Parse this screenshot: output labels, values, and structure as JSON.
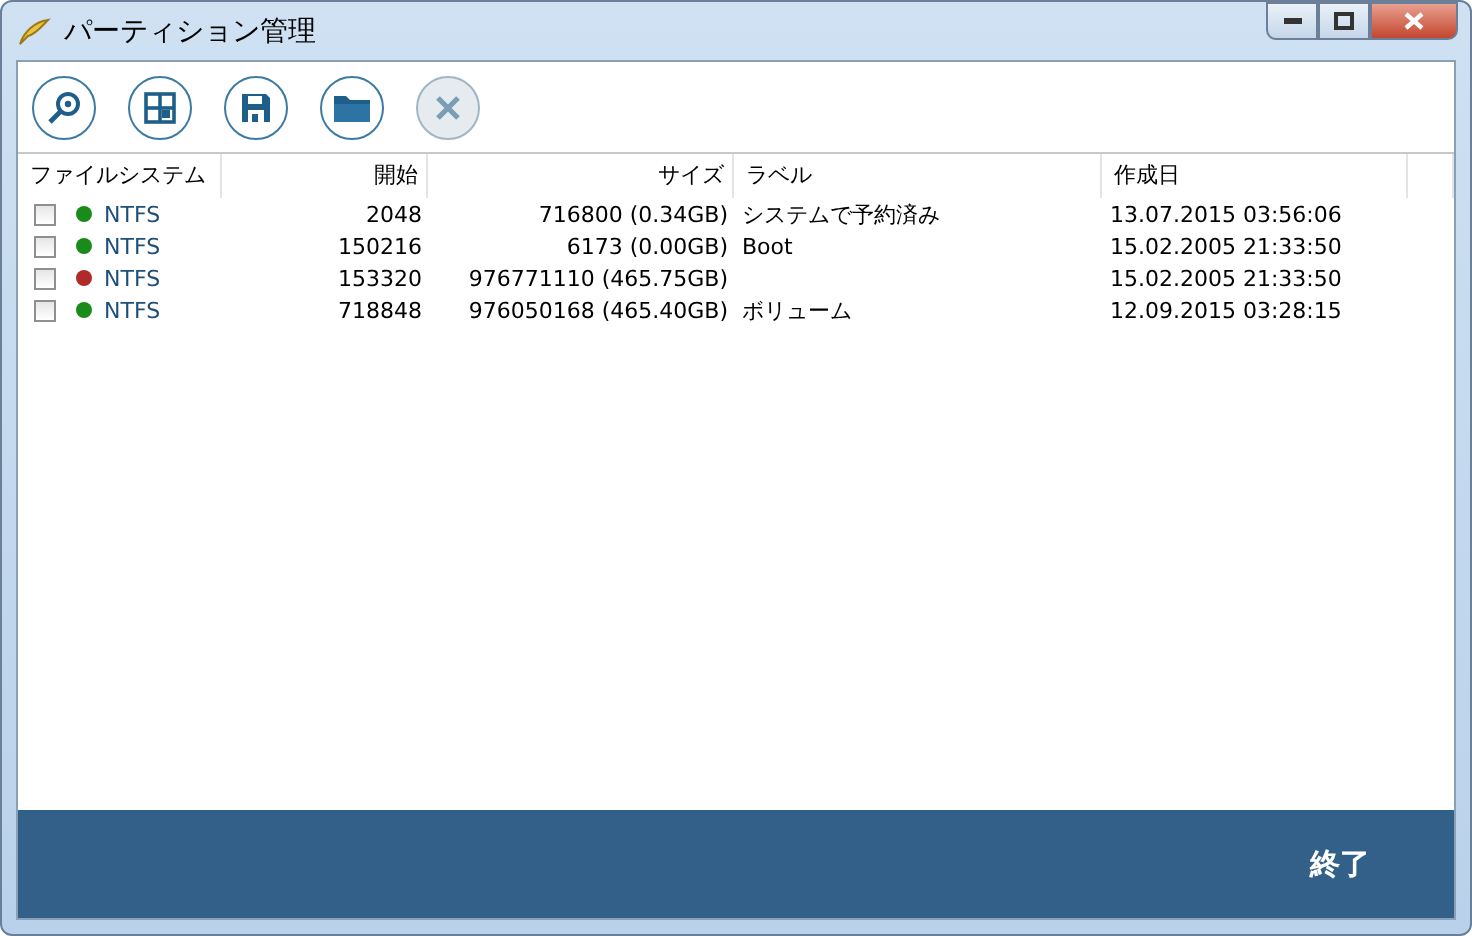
{
  "window": {
    "title": "パーティション管理"
  },
  "toolbar": [
    {
      "kind": "search",
      "disabled": false
    },
    {
      "kind": "grid",
      "disabled": false
    },
    {
      "kind": "save",
      "disabled": false
    },
    {
      "kind": "folder",
      "disabled": false
    },
    {
      "kind": "close",
      "disabled": true
    }
  ],
  "table": {
    "columns": [
      "ファイルシステム",
      "開始",
      "サイズ",
      "ラベル",
      "作成日"
    ],
    "rows": [
      {
        "checked": false,
        "color": "#1a8a1a",
        "filesystem": "NTFS",
        "start": "2048",
        "size": "716800 (0.34GB)",
        "label": "システムで予約済み",
        "created": "13.07.2015 03:56:06"
      },
      {
        "checked": false,
        "color": "#1a8a1a",
        "filesystem": "NTFS",
        "start": "150216",
        "size": "6173 (0.00GB)",
        "label": "Boot",
        "created": "15.02.2005 21:33:50"
      },
      {
        "checked": false,
        "color": "#b02a2a",
        "filesystem": "NTFS",
        "start": "153320",
        "size": "976771110 (465.75GB)",
        "created": "15.02.2005 21:33:50"
      },
      {
        "checked": false,
        "color": "#1a8a1a",
        "filesystem": "NTFS",
        "start": "718848",
        "size": "976050168 (465.40GB)",
        "label": "ボリューム",
        "created": "12.09.2015 03:28:15"
      }
    ]
  },
  "footer": {
    "button": "終了"
  }
}
